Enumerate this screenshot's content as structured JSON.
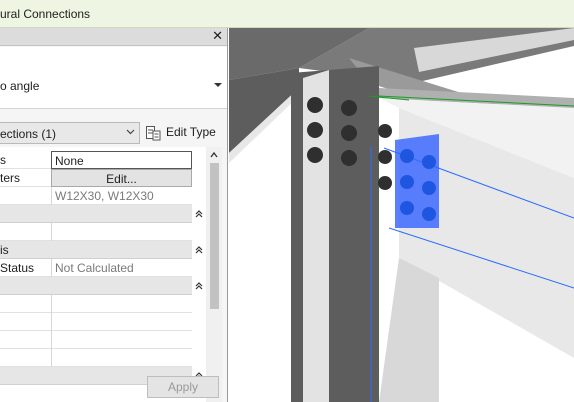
{
  "window": {
    "title": "ural Connections"
  },
  "panel": {
    "type_name": "o angle",
    "filter_label": "ections (1)",
    "edit_type_label": "Edit Type",
    "apply_label": "Apply",
    "rows": [
      {
        "kind": "prop",
        "key": "s",
        "value": "None",
        "style": "boxed"
      },
      {
        "kind": "prop",
        "key": "ters",
        "value": "Edit...",
        "style": "btn"
      },
      {
        "kind": "prop",
        "key": "",
        "value": "W12X30, W12X30",
        "style": "gray"
      },
      {
        "kind": "group",
        "key": ""
      },
      {
        "kind": "prop",
        "key": "",
        "value": "",
        "style": ""
      },
      {
        "kind": "group",
        "key": "is"
      },
      {
        "kind": "prop",
        "key": "Status",
        "value": "Not Calculated",
        "style": "gray"
      },
      {
        "kind": "group",
        "key": ""
      },
      {
        "kind": "prop",
        "key": "",
        "value": "",
        "style": ""
      },
      {
        "kind": "prop",
        "key": "",
        "value": "",
        "style": ""
      },
      {
        "kind": "prop",
        "key": "",
        "value": "",
        "style": ""
      },
      {
        "kind": "prop",
        "key": "",
        "value": "",
        "style": ""
      },
      {
        "kind": "group",
        "key": ""
      }
    ]
  },
  "viewport": {
    "colors": {
      "steel_dark": "#5d5d5d",
      "steel_light": "#e7e7e7",
      "bolt_dark": "#2f2f2f",
      "selection_blue": "#2a6cff",
      "guide_green": "#1a9c28"
    }
  }
}
